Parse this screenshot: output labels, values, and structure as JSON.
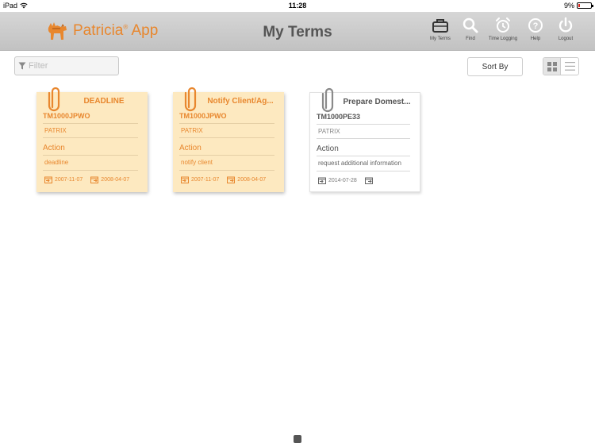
{
  "status": {
    "carrier": "iPad",
    "time": "11:28",
    "battery": "9%",
    "battery_level": 0.09
  },
  "header": {
    "logo_text": "Patricia",
    "logo_sup": "®",
    "logo_text2": "App",
    "title": "My Terms",
    "nav": [
      {
        "label": "My Terms",
        "icon": "briefcase-icon"
      },
      {
        "label": "Find",
        "icon": "search-icon"
      },
      {
        "label": "Time Logging",
        "icon": "alarm-clock-icon"
      },
      {
        "label": "Help",
        "icon": "help-icon"
      },
      {
        "label": "Logout",
        "icon": "power-icon"
      }
    ]
  },
  "toolbar": {
    "filter_placeholder": "Filter",
    "filter_value": "",
    "sort_label": "Sort By",
    "view_mode": "grid"
  },
  "cards": [
    {
      "style": "note",
      "title": "DEADLINE",
      "code": "TM1000JPWO",
      "client": "PATRIX",
      "action_label": "Action",
      "action": "deadline",
      "date_start": "2007-11-07",
      "date_end": "2008-04-07"
    },
    {
      "style": "note",
      "title": "Notify Client/Ag...",
      "code": "TM1000JPWO",
      "client": "PATRIX",
      "action_label": "Action",
      "action": "notify client",
      "date_start": "2007-11-07",
      "date_end": "2008-04-07"
    },
    {
      "style": "plain",
      "title": "Prepare Domest...",
      "code": "TM1000PE33",
      "client": "PATRIX",
      "action_label": "Action",
      "action": "request additional information",
      "date_start": "2014-07-28",
      "date_end": ""
    }
  ],
  "colors": {
    "accent": "#e8872e",
    "note_bg": "#fde9c0",
    "header_bg": "#c9c9c9"
  }
}
